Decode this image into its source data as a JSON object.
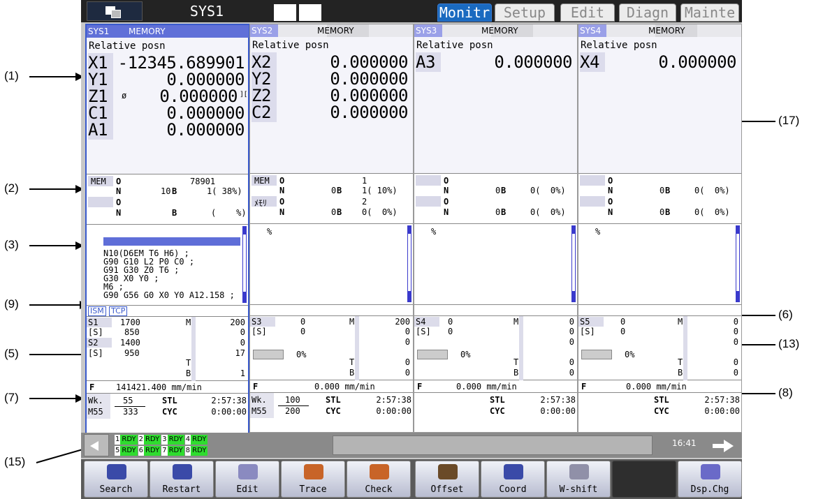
{
  "callouts": [
    "(1)",
    "(2)",
    "(3)",
    "(9)",
    "(5)",
    "(7)",
    "(15)",
    "(17)",
    "(6)",
    "(13)",
    "(8)"
  ],
  "top": {
    "sys_name": "SYS1",
    "tabs": [
      "Monitr",
      "Setup",
      "Edit",
      "Diagn",
      "Mainte"
    ]
  },
  "systems": [
    {
      "name": "SYS1",
      "mode": "MEMORY",
      "title": "Relative posn",
      "axes": [
        {
          "n": "X1",
          "v": "-12345.689901"
        },
        {
          "n": "Y1",
          "v": "0.000000"
        },
        {
          "n": "Z1",
          "v": "0.000000",
          "extra": "ø",
          "mark": "]["
        },
        {
          "n": "C1",
          "v": "0.000000"
        },
        {
          "n": "A1",
          "v": "0.000000"
        }
      ],
      "prog": {
        "mem": "MEM",
        "o1": "O",
        "o1v": "78901",
        "n1": "N",
        "n1v": "10",
        "b1": "B",
        "b1v": "1( 38%)",
        "o2": "O",
        "n2": "N",
        "b2": "B",
        "b2v": "(    %)"
      },
      "code": [
        "N10(D6EM T6 H6) ;",
        "G90 G10 L2 P0 C0 ;",
        "G91 G30 Z0 T6 ;",
        "G30 X0 Y0 ;",
        "M6 ;",
        "G90 G56 G0 X0 Y0 A12.158 ;"
      ],
      "tags": [
        "ISM",
        "TCP"
      ],
      "spindle": {
        "s1": "S1",
        "s1v": "1700",
        "s1sub": "[S]",
        "s1subv": "850",
        "s2": "S2",
        "s2v": "1400",
        "s2sub": "[S]",
        "s2subv": "950",
        "m": "M",
        "mv": [
          "200",
          "0",
          "0"
        ],
        "t": "T",
        "tv": "17",
        "b": "B",
        "bv": "1"
      },
      "feed": {
        "f": "F",
        "fv": "141421.400 mm/min"
      },
      "foot": {
        "wk": "Wk.",
        "m55": "M55",
        "wk1": "55",
        "wk2": "333",
        "stl": "STL",
        "stlv": "2:57:38",
        "cyc": "CYC",
        "cycv": "0:00:00"
      }
    },
    {
      "name": "SYS2",
      "mode": "MEMORY",
      "title": "Relative posn",
      "axes": [
        {
          "n": "X2",
          "v": "0.000000"
        },
        {
          "n": "Y2",
          "v": "0.000000"
        },
        {
          "n": "Z2",
          "v": "0.000000"
        },
        {
          "n": "C2",
          "v": "0.000000"
        }
      ],
      "prog": {
        "mem": "MEM",
        "o1": "O",
        "o1v": "1",
        "n1": "N",
        "n1v": "0",
        "b1": "B",
        "b1v": "1( 10%)",
        "mem2": "ﾒﾓﾘ",
        "o2": "O",
        "o2v": "2",
        "n2": "N",
        "n2v": "0",
        "b2": "B",
        "b2v": "0(  0%)"
      },
      "code": [
        "%"
      ],
      "spindle": {
        "s1": "S3",
        "s1v": "0",
        "s1sub": "[S]",
        "s1subv": "0",
        "pct": "0%",
        "m": "M",
        "mv": [
          "200",
          "0",
          "0"
        ],
        "t": "T",
        "tv": "0",
        "b": "B",
        "bv": "0"
      },
      "feed": {
        "f": "F",
        "fv": "0.000 mm/min"
      },
      "foot": {
        "wk": "Wk.",
        "m55": "M55",
        "wk1": "100",
        "wk2": "200",
        "stl": "STL",
        "stlv": "2:57:38",
        "cyc": "CYC",
        "cycv": "0:00:00"
      }
    },
    {
      "name": "SYS3",
      "mode": "MEMORY",
      "title": "Relative posn",
      "axes": [
        {
          "n": "A3",
          "v": "0.000000"
        }
      ],
      "prog": {
        "o1": "O",
        "n1": "N",
        "n1v": "0",
        "b1": "B",
        "b1v": "0(  0%)",
        "o2": "O",
        "n2": "N",
        "n2v": "0",
        "b2": "B",
        "b2v": "0(  0%)"
      },
      "code": [
        "%"
      ],
      "spindle": {
        "s1": "S4",
        "s1v": "0",
        "s1sub": "[S]",
        "s1subv": "0",
        "pct": "0%",
        "m": "M",
        "mv": [
          "0",
          "0",
          "0"
        ],
        "t": "T",
        "tv": "0",
        "b": "B",
        "bv": "0"
      },
      "feed": {
        "f": "F",
        "fv": "0.000 mm/min"
      },
      "foot": {
        "stl": "STL",
        "stlv": "2:57:38",
        "cyc": "CYC",
        "cycv": "0:00:00"
      }
    },
    {
      "name": "SYS4",
      "mode": "MEMORY",
      "title": "Relative posn",
      "axes": [
        {
          "n": "X4",
          "v": "0.000000"
        }
      ],
      "prog": {
        "o1": "O",
        "n1": "N",
        "n1v": "0",
        "b1": "B",
        "b1v": "0(  0%)",
        "o2": "O",
        "n2": "N",
        "n2v": "0",
        "b2": "B",
        "b2v": "0(  0%)"
      },
      "code": [
        "%"
      ],
      "spindle": {
        "s1": "S5",
        "s1v": "0",
        "s1sub": "[S]",
        "s1subv": "0",
        "pct": "0%",
        "m": "M",
        "mv": [
          "0",
          "0",
          "0"
        ],
        "t": "T",
        "tv": "0",
        "b": "B",
        "bv": "0"
      },
      "feed": {
        "f": "F",
        "fv": "0.000 mm/min"
      },
      "foot": {
        "stl": "STL",
        "stlv": "2:57:38",
        "cyc": "CYC",
        "cycv": "0:00:00"
      }
    }
  ],
  "status": {
    "rdy_row1": [
      [
        "1",
        "RDY"
      ],
      [
        "2",
        "RDY"
      ],
      [
        "3",
        "RDY"
      ],
      [
        "4",
        "RDY"
      ]
    ],
    "rdy_row2": [
      [
        "5",
        "RDY"
      ],
      [
        "6",
        "RDY"
      ],
      [
        "7",
        "RDY"
      ],
      [
        "8",
        "RDY"
      ]
    ],
    "clock": "16:41"
  },
  "fkeys": [
    {
      "label": "Search",
      "icon": "search-icon",
      "color": "#3a4aa8"
    },
    {
      "label": "Restart",
      "icon": "restart-icon",
      "color": "#3a4aa8"
    },
    {
      "label": "Edit",
      "icon": "edit-icon",
      "color": "#8a8ac0"
    },
    {
      "label": "Trace",
      "icon": "trace-icon",
      "color": "#c86428"
    },
    {
      "label": "Check",
      "icon": "check-icon",
      "color": "#c86428"
    },
    {
      "label": "Offset",
      "icon": "offset-icon",
      "color": "#6a4a28"
    },
    {
      "label": "Coord",
      "icon": "coord-icon",
      "color": "#3a4aa8"
    },
    {
      "label": "W-shift",
      "icon": "wshift-icon",
      "color": "#9090a8"
    },
    {
      "label": "",
      "icon": "",
      "color": ""
    },
    {
      "label": "Dsp.Chg",
      "icon": "display-change-icon",
      "color": "#6a6ac8"
    }
  ]
}
